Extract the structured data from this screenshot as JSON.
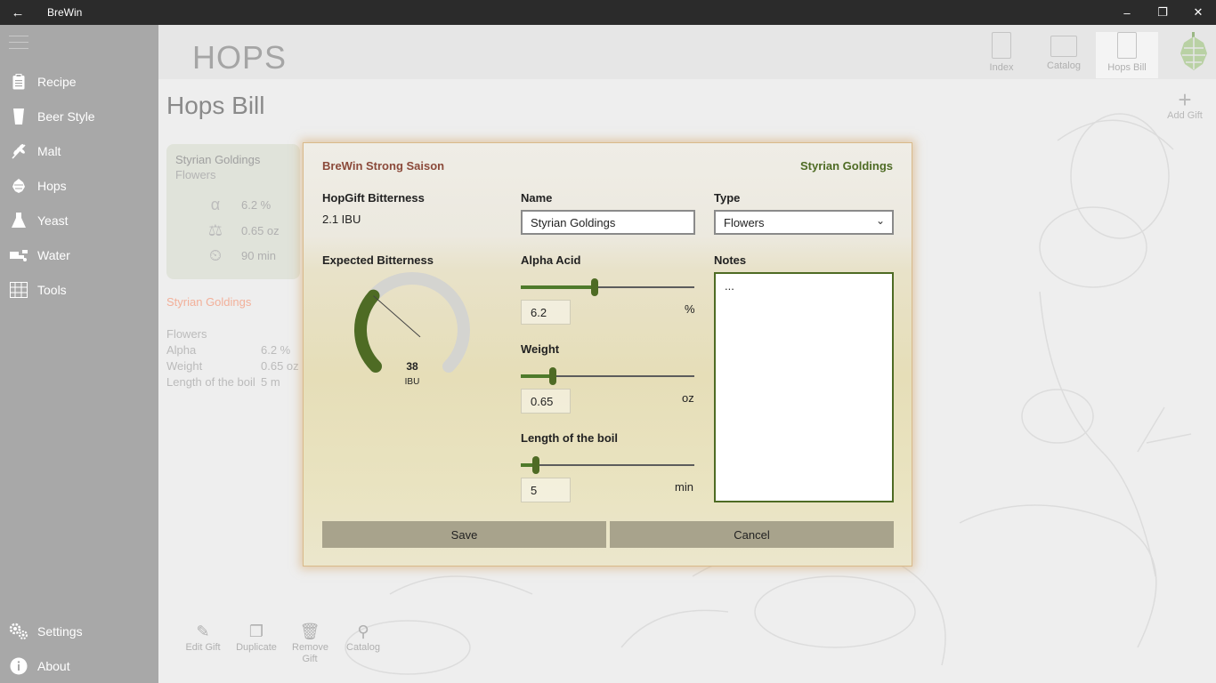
{
  "titlebar": {
    "title": "BreWin",
    "back_icon": "back-arrow-icon"
  },
  "sidebar": {
    "items": [
      {
        "label": "Recipe",
        "icon": "clipboard-icon"
      },
      {
        "label": "Beer Style",
        "icon": "glass-icon"
      },
      {
        "label": "Malt",
        "icon": "wheat-icon"
      },
      {
        "label": "Hops",
        "icon": "hop-icon"
      },
      {
        "label": "Yeast",
        "icon": "flask-icon"
      },
      {
        "label": "Water",
        "icon": "water-icon"
      },
      {
        "label": "Tools",
        "icon": "tools-icon"
      }
    ],
    "bottom": [
      {
        "label": "Settings",
        "icon": "gear-icon"
      },
      {
        "label": "About",
        "icon": "info-icon"
      }
    ]
  },
  "header": {
    "title": "HOPS",
    "nav": [
      {
        "label": "Index"
      },
      {
        "label": "Catalog"
      },
      {
        "label": "Hops Bill"
      }
    ]
  },
  "page": {
    "title": "Hops Bill",
    "add_gift": "Add Gift"
  },
  "gift_card": {
    "name": "Styrian Goldings",
    "type": "Flowers",
    "alpha": "6.2 %",
    "weight": "0.65 oz",
    "time": "90 min"
  },
  "detail": {
    "title": "Styrian Goldings",
    "type": "Flowers",
    "rows": [
      {
        "key": "Alpha",
        "value": "6.2 %"
      },
      {
        "key": "Weight",
        "value": "0.65 oz"
      },
      {
        "key": "Length of the boil",
        "value": "5 m"
      }
    ]
  },
  "bottom_bar": [
    {
      "label": "Edit Gift"
    },
    {
      "label": "Duplicate"
    },
    {
      "label": "Remove Gift"
    },
    {
      "label": "Catalog"
    }
  ],
  "dialog": {
    "recipe": "BreWin Strong Saison",
    "hop": "Styrian Goldings",
    "hopgift_label": "HopGift Bitterness",
    "hopgift_value": "2.1 IBU",
    "expected_label": "Expected Bitterness",
    "gauge": {
      "value": "38",
      "unit": "IBU",
      "level": 0.32,
      "accent": "#4e6b24"
    },
    "name_label": "Name",
    "name_value": "Styrian Goldings",
    "type_label": "Type",
    "type_value": "Flowers",
    "alpha_label": "Alpha Acid",
    "alpha_value": "6.2",
    "alpha_unit": "%",
    "alpha_level": 0.42,
    "weight_label": "Weight",
    "weight_value": "0.65",
    "weight_unit": "oz",
    "weight_level": 0.17,
    "boil_label": "Length of the boil",
    "boil_value": "5",
    "boil_unit": "min",
    "boil_level": 0.07,
    "notes_label": "Notes",
    "notes_value": "...",
    "save": "Save",
    "cancel": "Cancel"
  }
}
